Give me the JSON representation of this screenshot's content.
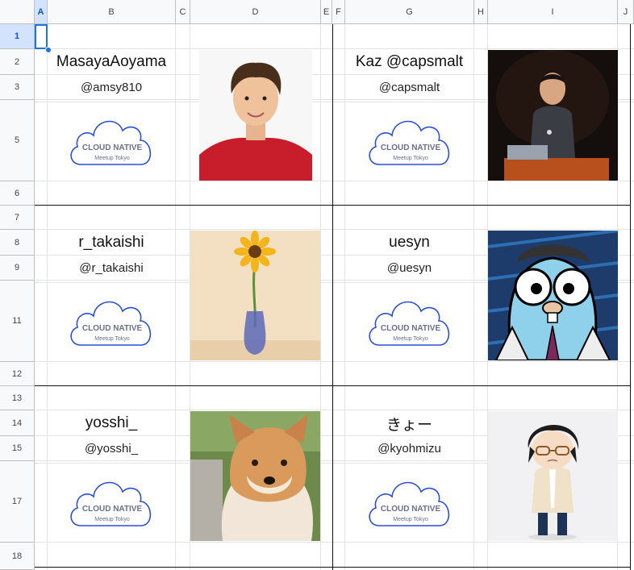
{
  "columns": [
    "A",
    "B",
    "C",
    "D",
    "E",
    "F",
    "G",
    "H",
    "I",
    "J"
  ],
  "active_column": "A",
  "rows": [
    "1",
    "2",
    "3",
    "5",
    "6",
    "7",
    "8",
    "9",
    "11",
    "12",
    "13",
    "14",
    "15",
    "17",
    "18"
  ],
  "active_row": "1",
  "logo": {
    "line1": "CLOUD NATIVE",
    "line2": "Meetup Tokyo",
    "color": "#2b4fd8"
  },
  "people": [
    {
      "name": "MasayaAoyama",
      "handle": "@amsy810",
      "photo": "photo-young-man-red-sweater"
    },
    {
      "name": "Kaz @capsmalt",
      "handle": "@capsmalt",
      "photo": "photo-speaker-on-stage"
    },
    {
      "name": "r_takaishi",
      "handle": "@r_takaishi",
      "photo": "photo-sunflower-vase"
    },
    {
      "name": "uesyn",
      "handle": "@uesyn",
      "photo": "photo-gopher-illustration"
    },
    {
      "name": "yosshi_",
      "handle": "@yosshi_",
      "photo": "photo-shiba-dog"
    },
    {
      "name": "きょー",
      "handle": "@kyohmizu",
      "photo": "photo-anime-character"
    }
  ]
}
